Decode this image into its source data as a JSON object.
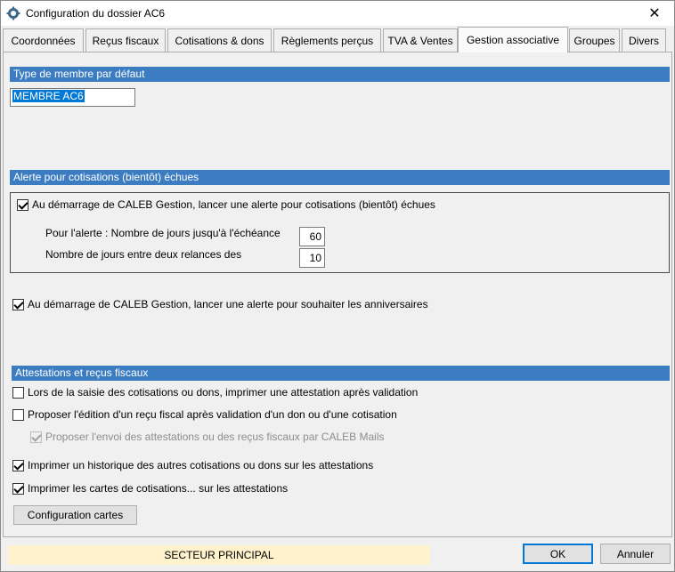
{
  "window": {
    "title": "Configuration du dossier AC6",
    "close_glyph": "✕"
  },
  "tabs": [
    {
      "label": "Coordonnées"
    },
    {
      "label": "Reçus fiscaux"
    },
    {
      "label": "Cotisations & dons"
    },
    {
      "label": "Règlements perçus"
    },
    {
      "label": "TVA & Ventes"
    },
    {
      "label": "Gestion associative",
      "active": true
    },
    {
      "label": "Groupes"
    },
    {
      "label": "Divers"
    }
  ],
  "member_type": {
    "header": "Type de membre par défaut",
    "value": "MEMBRE AC6"
  },
  "alert": {
    "header": "Alerte pour cotisations (bientôt) échues",
    "startup_alert_label": "Au démarrage de CALEB Gestion, lancer une alerte pour cotisations (bientôt) échues",
    "startup_alert_checked": true,
    "days_to_due_label": "Pour l'alerte : Nombre de jours jusqu'à l'échéance",
    "days_to_due_value": "60",
    "days_between_reminders_label": "Nombre de jours entre deux relances des",
    "days_between_reminders_value": "10"
  },
  "birthday": {
    "label": "Au démarrage de CALEB Gestion, lancer une alerte pour souhaiter les anniversaires",
    "checked": true
  },
  "attestations": {
    "header": "Attestations et reçus fiscaux",
    "print_attestation_label": "Lors de la saisie des cotisations ou dons, imprimer une attestation après validation",
    "print_attestation_checked": false,
    "propose_receipt_label": "Proposer l'édition d'un reçu fiscal après validation d'un don ou d'une cotisation",
    "propose_receipt_checked": false,
    "propose_mail_label": "Proposer l'envoi des attestations ou des reçus fiscaux par CALEB Mails",
    "propose_mail_checked": true,
    "history_label": "Imprimer un historique des autres cotisations ou dons sur les attestations",
    "history_checked": true,
    "cards_label": "Imprimer les cartes de cotisations... sur les attestations",
    "cards_checked": true,
    "config_cards_button": "Configuration cartes"
  },
  "footer": {
    "sector": "SECTEUR PRINCIPAL",
    "ok_label": "OK",
    "cancel_label": "Annuler"
  },
  "colors": {
    "section_header": "#3c7dc2",
    "status_background": "#fff2cc",
    "selection": "#0078d7"
  }
}
